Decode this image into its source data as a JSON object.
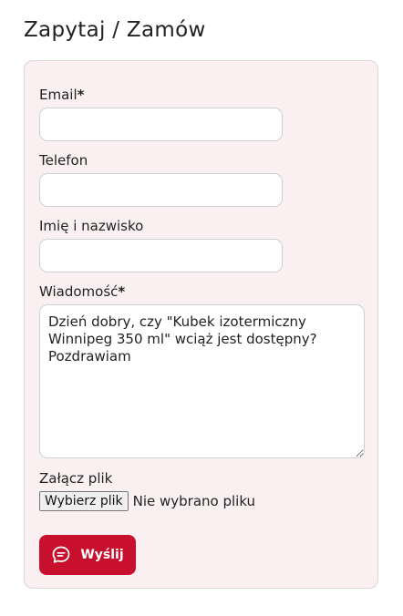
{
  "page": {
    "title": "Zapytaj / Zamów"
  },
  "form": {
    "email": {
      "label": "Email",
      "required_mark": "*",
      "value": ""
    },
    "phone": {
      "label": "Telefon",
      "value": ""
    },
    "name": {
      "label": "Imię i nazwisko",
      "value": ""
    },
    "message": {
      "label": "Wiadomość",
      "required_mark": "*",
      "value": "Dzień dobry, czy \"Kubek izotermiczny Winnipeg 350 ml\" wciąż jest dostępny?\nPozdrawiam"
    },
    "attachment": {
      "label": "Załącz plik",
      "button_label": "Wybierz plik",
      "status": "Nie wybrano pliku"
    },
    "submit": {
      "label": "Wyślij",
      "icon": "chat-bubble-icon"
    }
  },
  "colors": {
    "accent": "#c8102e",
    "panel_background": "#faf0f1"
  }
}
